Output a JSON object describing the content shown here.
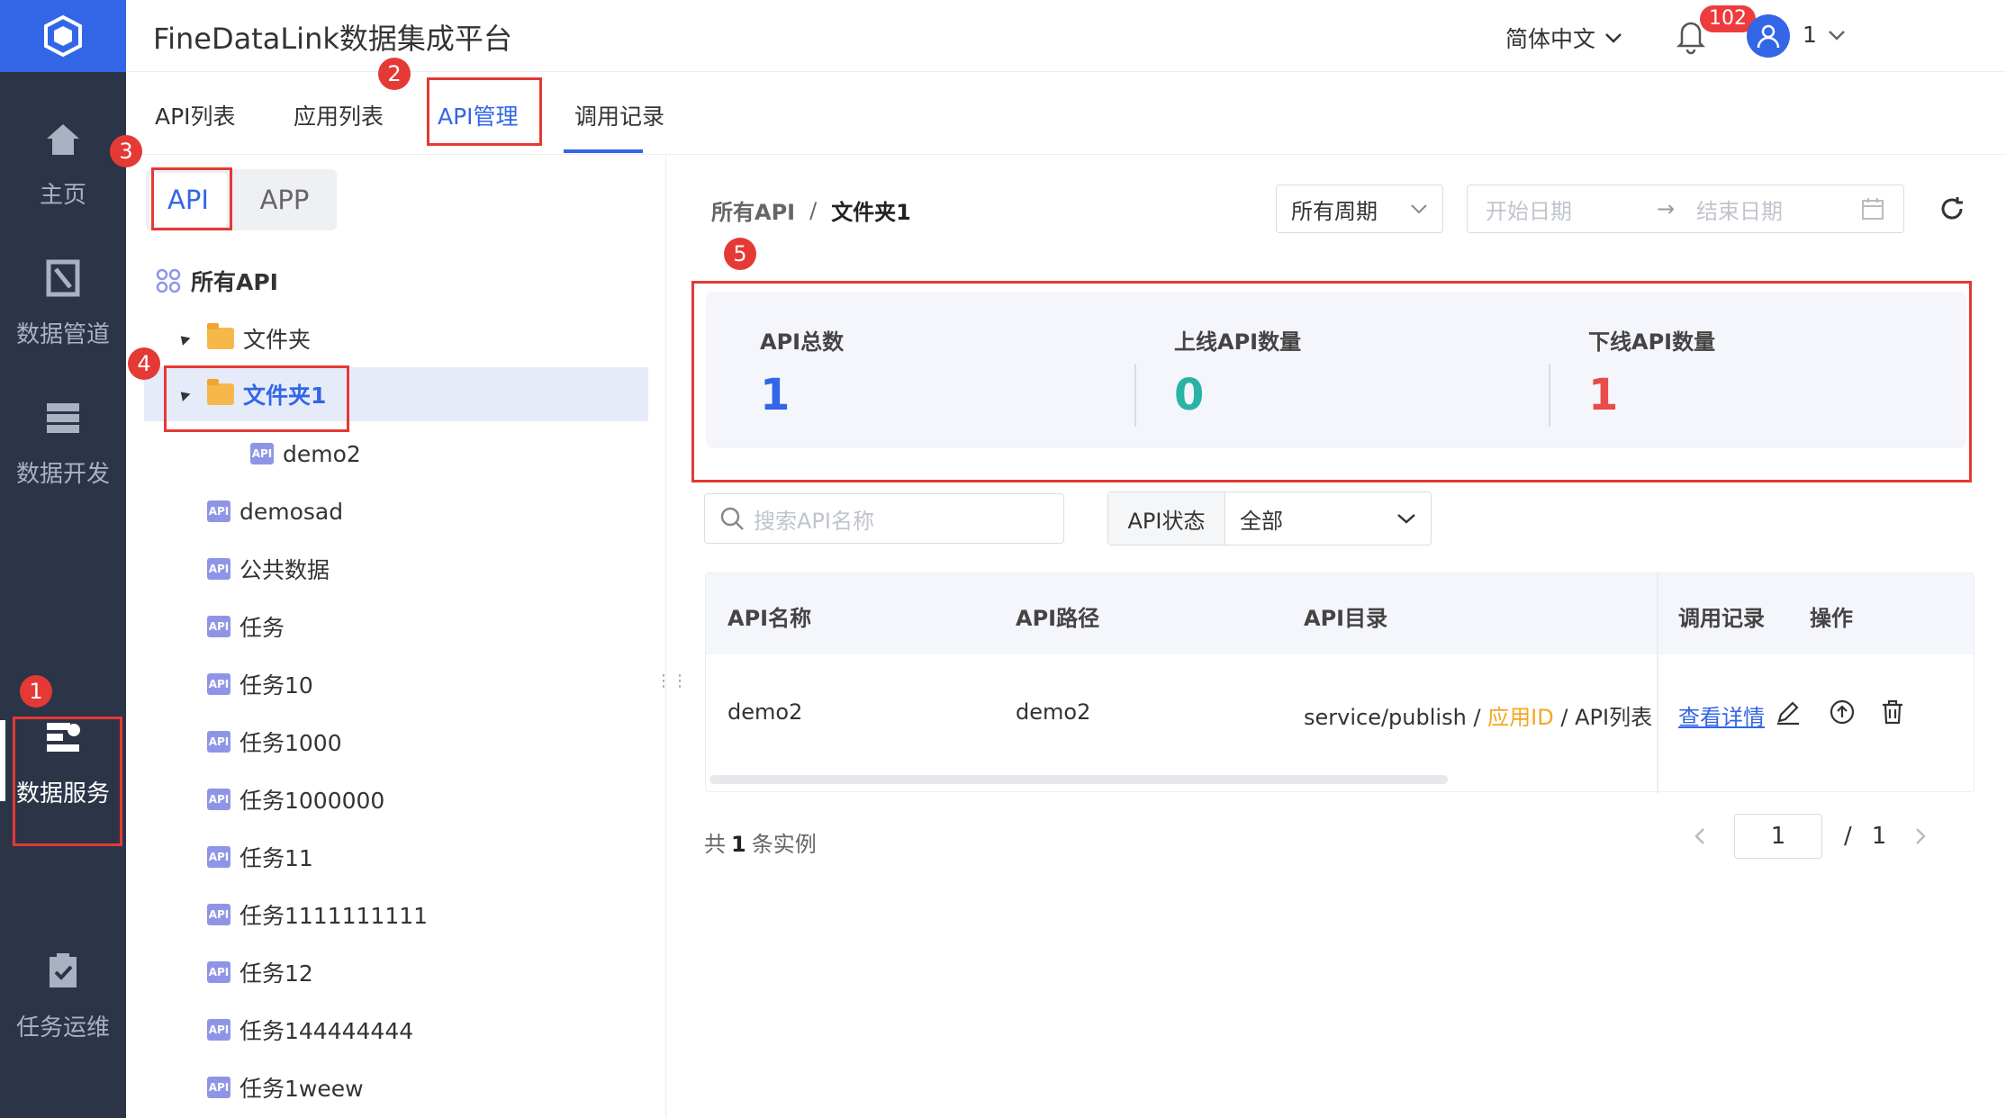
{
  "header": {
    "title": "FineDataLink数据集成平台",
    "language": "简体中文",
    "notification_count": "102",
    "user": "1"
  },
  "nav": {
    "items": [
      {
        "label": "主页",
        "icon": "home-icon"
      },
      {
        "label": "数据管道",
        "icon": "pipeline-icon"
      },
      {
        "label": "数据开发",
        "icon": "dev-icon"
      },
      {
        "label": "数据服务",
        "icon": "service-icon"
      },
      {
        "label": "任务运维",
        "icon": "ops-icon"
      }
    ]
  },
  "tabs": [
    "API列表",
    "应用列表",
    "API管理",
    "调用记录"
  ],
  "tree": {
    "segments": [
      "API",
      "APP"
    ],
    "root": "所有API",
    "folder": "文件夹",
    "folder1": "文件夹1",
    "badge": "API",
    "items": [
      "demo2",
      "demosad",
      "公共数据",
      "任务",
      "任务10",
      "任务1000",
      "任务1000000",
      "任务11",
      "任务1111111111",
      "任务12",
      "任务144444444",
      "任务1weew"
    ]
  },
  "breadcrumb": {
    "root": "所有API",
    "sep": "/",
    "current": "文件夹1"
  },
  "filters": {
    "period": "所有周期",
    "start_placeholder": "开始日期",
    "end_placeholder": "结束日期",
    "arrow": "→",
    "search_placeholder": "搜索API名称",
    "status_label": "API状态",
    "status_value": "全部"
  },
  "stats": {
    "total_label": "API总数",
    "total_value": "1",
    "online_label": "上线API数量",
    "online_value": "0",
    "offline_label": "下线API数量",
    "offline_value": "1"
  },
  "table": {
    "headers": [
      "API名称",
      "API路径",
      "API目录",
      "调用记录",
      "操作"
    ],
    "row": {
      "name": "demo2",
      "path": "demo2",
      "dir_a": "service/publish",
      "dir_sep": "/",
      "dir_b": "应用ID",
      "dir_c": "API列表",
      "call_link": "查看详情"
    }
  },
  "pagination": {
    "prefix": "共",
    "count": "1",
    "suffix": "条实例",
    "page": "1",
    "slash": "/",
    "total_pages": "1"
  },
  "markers": [
    "1",
    "2",
    "3",
    "4",
    "5"
  ],
  "colors": {
    "accent": "#3366e6",
    "sidebar": "#2c3448",
    "online": "#2ab3a5",
    "offline": "#e94b4b",
    "annotation": "#e53935"
  }
}
